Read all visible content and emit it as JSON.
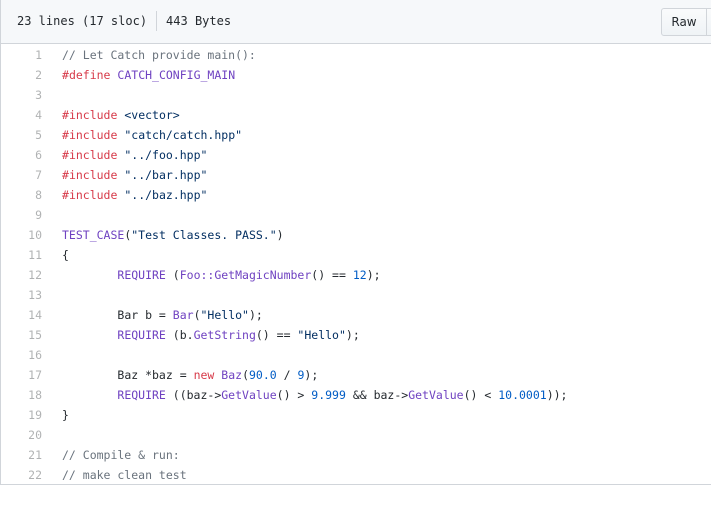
{
  "file_header": {
    "lines_info": "23 lines (17 sloc)",
    "size_info": "443 Bytes",
    "raw_label": "Raw"
  },
  "colors": {
    "comment": "#6a737d",
    "keyword": "#d73a49",
    "entity": "#6f42c1",
    "string": "#032f62",
    "constant": "#005cc5",
    "text": "#24292e"
  },
  "code_lines": [
    {
      "n": "1",
      "tokens": [
        {
          "t": "// Let Catch provide main():",
          "c": "comment"
        }
      ]
    },
    {
      "n": "2",
      "tokens": [
        {
          "t": "#",
          "c": "keyword"
        },
        {
          "t": "define",
          "c": "keyword"
        },
        {
          "t": " ",
          "c": ""
        },
        {
          "t": "CATCH_CONFIG_MAIN",
          "c": "entity"
        }
      ]
    },
    {
      "n": "3",
      "tokens": []
    },
    {
      "n": "4",
      "tokens": [
        {
          "t": "#",
          "c": "keyword"
        },
        {
          "t": "include",
          "c": "keyword"
        },
        {
          "t": " ",
          "c": ""
        },
        {
          "t": "<vector>",
          "c": "string"
        }
      ]
    },
    {
      "n": "5",
      "tokens": [
        {
          "t": "#",
          "c": "keyword"
        },
        {
          "t": "include",
          "c": "keyword"
        },
        {
          "t": " ",
          "c": ""
        },
        {
          "t": "\"catch/catch.hpp\"",
          "c": "string"
        }
      ]
    },
    {
      "n": "6",
      "tokens": [
        {
          "t": "#",
          "c": "keyword"
        },
        {
          "t": "include",
          "c": "keyword"
        },
        {
          "t": " ",
          "c": ""
        },
        {
          "t": "\"../foo.hpp\"",
          "c": "string"
        }
      ]
    },
    {
      "n": "7",
      "tokens": [
        {
          "t": "#",
          "c": "keyword"
        },
        {
          "t": "include",
          "c": "keyword"
        },
        {
          "t": " ",
          "c": ""
        },
        {
          "t": "\"../bar.hpp\"",
          "c": "string"
        }
      ]
    },
    {
      "n": "8",
      "tokens": [
        {
          "t": "#",
          "c": "keyword"
        },
        {
          "t": "include",
          "c": "keyword"
        },
        {
          "t": " ",
          "c": ""
        },
        {
          "t": "\"../baz.hpp\"",
          "c": "string"
        }
      ]
    },
    {
      "n": "9",
      "tokens": []
    },
    {
      "n": "10",
      "tokens": [
        {
          "t": "TEST_CASE",
          "c": "entity"
        },
        {
          "t": "(",
          "c": ""
        },
        {
          "t": "\"Test Classes. PASS.\"",
          "c": "string"
        },
        {
          "t": ")",
          "c": ""
        }
      ]
    },
    {
      "n": "11",
      "tokens": [
        {
          "t": "{",
          "c": ""
        }
      ]
    },
    {
      "n": "12",
      "tokens": [
        {
          "t": "\t",
          "c": ""
        },
        {
          "t": "REQUIRE",
          "c": "entity"
        },
        {
          "t": " (",
          "c": ""
        },
        {
          "t": "Foo::GetMagicNumber",
          "c": "entity"
        },
        {
          "t": "() == ",
          "c": ""
        },
        {
          "t": "12",
          "c": "constant"
        },
        {
          "t": ");",
          "c": ""
        }
      ]
    },
    {
      "n": "13",
      "tokens": []
    },
    {
      "n": "14",
      "tokens": [
        {
          "t": "\tBar b = ",
          "c": ""
        },
        {
          "t": "Bar",
          "c": "entity"
        },
        {
          "t": "(",
          "c": ""
        },
        {
          "t": "\"Hello\"",
          "c": "string"
        },
        {
          "t": ");",
          "c": ""
        }
      ]
    },
    {
      "n": "15",
      "tokens": [
        {
          "t": "\t",
          "c": ""
        },
        {
          "t": "REQUIRE",
          "c": "entity"
        },
        {
          "t": " (b.",
          "c": ""
        },
        {
          "t": "GetString",
          "c": "entity"
        },
        {
          "t": "() == ",
          "c": ""
        },
        {
          "t": "\"Hello\"",
          "c": "string"
        },
        {
          "t": ");",
          "c": ""
        }
      ]
    },
    {
      "n": "16",
      "tokens": []
    },
    {
      "n": "17",
      "tokens": [
        {
          "t": "\tBaz *baz = ",
          "c": ""
        },
        {
          "t": "new",
          "c": "keyword"
        },
        {
          "t": " ",
          "c": ""
        },
        {
          "t": "Baz",
          "c": "entity"
        },
        {
          "t": "(",
          "c": ""
        },
        {
          "t": "90.0",
          "c": "constant"
        },
        {
          "t": " / ",
          "c": ""
        },
        {
          "t": "9",
          "c": "constant"
        },
        {
          "t": ");",
          "c": ""
        }
      ]
    },
    {
      "n": "18",
      "tokens": [
        {
          "t": "\t",
          "c": ""
        },
        {
          "t": "REQUIRE",
          "c": "entity"
        },
        {
          "t": " ((baz->",
          "c": ""
        },
        {
          "t": "GetValue",
          "c": "entity"
        },
        {
          "t": "() > ",
          "c": ""
        },
        {
          "t": "9.999",
          "c": "constant"
        },
        {
          "t": " && baz->",
          "c": ""
        },
        {
          "t": "GetValue",
          "c": "entity"
        },
        {
          "t": "() < ",
          "c": ""
        },
        {
          "t": "10.0001",
          "c": "constant"
        },
        {
          "t": "));",
          "c": ""
        }
      ]
    },
    {
      "n": "19",
      "tokens": [
        {
          "t": "}",
          "c": ""
        }
      ]
    },
    {
      "n": "20",
      "tokens": []
    },
    {
      "n": "21",
      "tokens": [
        {
          "t": "// Compile & run:",
          "c": "comment"
        }
      ]
    },
    {
      "n": "22",
      "tokens": [
        {
          "t": "// make clean test",
          "c": "comment"
        }
      ]
    }
  ]
}
